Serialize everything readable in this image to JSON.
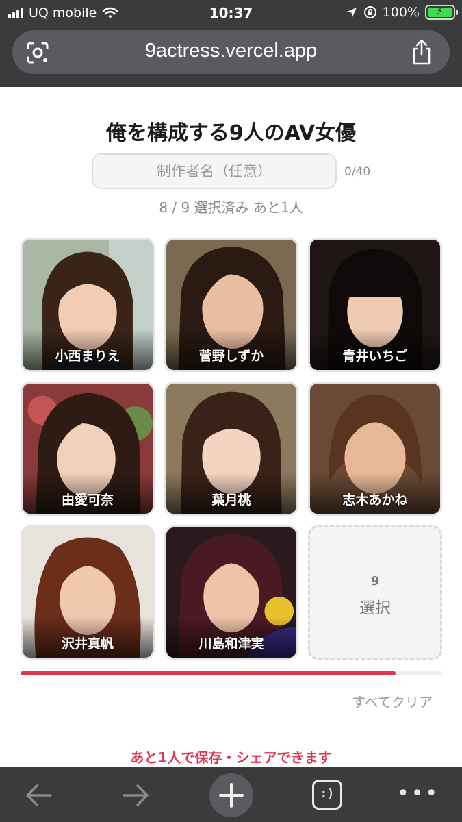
{
  "status_bar": {
    "carrier": "UQ mobile",
    "time": "10:37",
    "battery": "100%",
    "icons": [
      "signal-icon",
      "wifi-icon",
      "location-icon",
      "orientation-lock-icon",
      "battery-charging-icon"
    ]
  },
  "browser": {
    "url": "9actress.vercel.app",
    "icons": [
      "lens-icon",
      "share-icon"
    ]
  },
  "page": {
    "title": "俺を構成する9人のAV女優",
    "maker_placeholder": "制作者名（任意）",
    "maker_value": "",
    "char_count": "0/40",
    "select_status": "8 / 9 選択済み あと1人",
    "selected_count": 8,
    "total_slots": 9
  },
  "actresses": [
    {
      "name": "小西まりえ"
    },
    {
      "name": "菅野しずか"
    },
    {
      "name": "青井いちご"
    },
    {
      "name": "由愛可奈"
    },
    {
      "name": "葉月桃"
    },
    {
      "name": "志木あかね"
    },
    {
      "name": "沢井真帆"
    },
    {
      "name": "川島和津実"
    }
  ],
  "empty_slot": {
    "number": "9",
    "label": "選択"
  },
  "actions": {
    "clear_all": "すべてクリア",
    "hint": "あと1人で保存・シェアできます"
  },
  "colors": {
    "accent": "#e0344e",
    "chrome": "#3a3b3d",
    "url_bar": "#5a5b5f"
  },
  "toolbar": {
    "tabs_label": ":)",
    "icons": [
      "back-arrow-icon",
      "forward-arrow-icon",
      "plus-icon",
      "tabs-icon",
      "more-icon"
    ]
  }
}
